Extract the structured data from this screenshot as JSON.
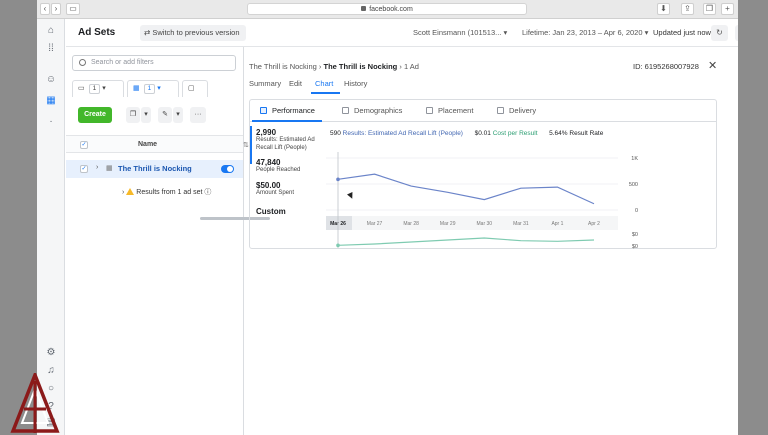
{
  "browser": {
    "url": "facebook.com"
  },
  "header": {
    "title": "Ad Sets",
    "switch_label": "Switch to previous version",
    "account": "Scott Einsmann (101513...",
    "date_range": "Lifetime: Jan 23, 2013 – Apr 6, 2020",
    "updated": "Updated just now",
    "more": "···"
  },
  "left": {
    "search_placeholder": "Search or add filters",
    "tabs": [
      {
        "count": "1"
      },
      {
        "count": "1"
      }
    ],
    "create_label": "Create",
    "more": "···",
    "col_name": "Name",
    "row_name": "The Thrill is Nocking",
    "sub_row": "Results from 1 ad set"
  },
  "detail": {
    "breadcrumb": [
      "The Thrill is Nocking",
      "The Thrill is Nocking",
      "1 Ad"
    ],
    "id_text": "ID: 6195268007928",
    "tabs": [
      "Summary",
      "Edit",
      "Chart",
      "History"
    ],
    "metric_tabs": [
      "Performance",
      "Demographics",
      "Placement",
      "Delivery"
    ],
    "metrics": [
      {
        "value": "2,990",
        "label1": "Results: Estimated Ad",
        "label2": "Recall Lift (People)"
      },
      {
        "value": "47,840",
        "label1": "People Reached",
        "label2": ""
      },
      {
        "value": "$50.00",
        "label1": "Amount Spent",
        "label2": ""
      }
    ],
    "custom_label": "Custom",
    "summary": {
      "results_value": "590",
      "results_label": "Results: Estimated Ad Recall Lift (People)",
      "cpr_value": "$0.01",
      "cpr_label": "Cost per Result",
      "rate_value": "5.64%",
      "rate_label": "Result Rate"
    }
  },
  "chart_data": {
    "type": "line",
    "x": [
      "Mar 26",
      "Mar 27",
      "Mar 28",
      "Mar 29",
      "Mar 30",
      "Mar 31",
      "Apr 1",
      "Apr 2"
    ],
    "series": [
      {
        "values": [
          590,
          690,
          460,
          340,
          200,
          420,
          440,
          120
        ],
        "color": "#6b84c9"
      },
      {
        "values": [
          0.009,
          0.0092,
          0.0095,
          0.0098,
          0.0101,
          0.0097,
          0.0096,
          0.0098
        ],
        "color": "#7fcbb1"
      }
    ],
    "y_ticks_top": [
      "1K",
      "500",
      "0"
    ],
    "y_ticks_bottom": [
      "$0",
      "$0"
    ],
    "ylim_top": [
      0,
      1000
    ],
    "ylim_bottom": [
      0.008,
      0.011
    ]
  }
}
